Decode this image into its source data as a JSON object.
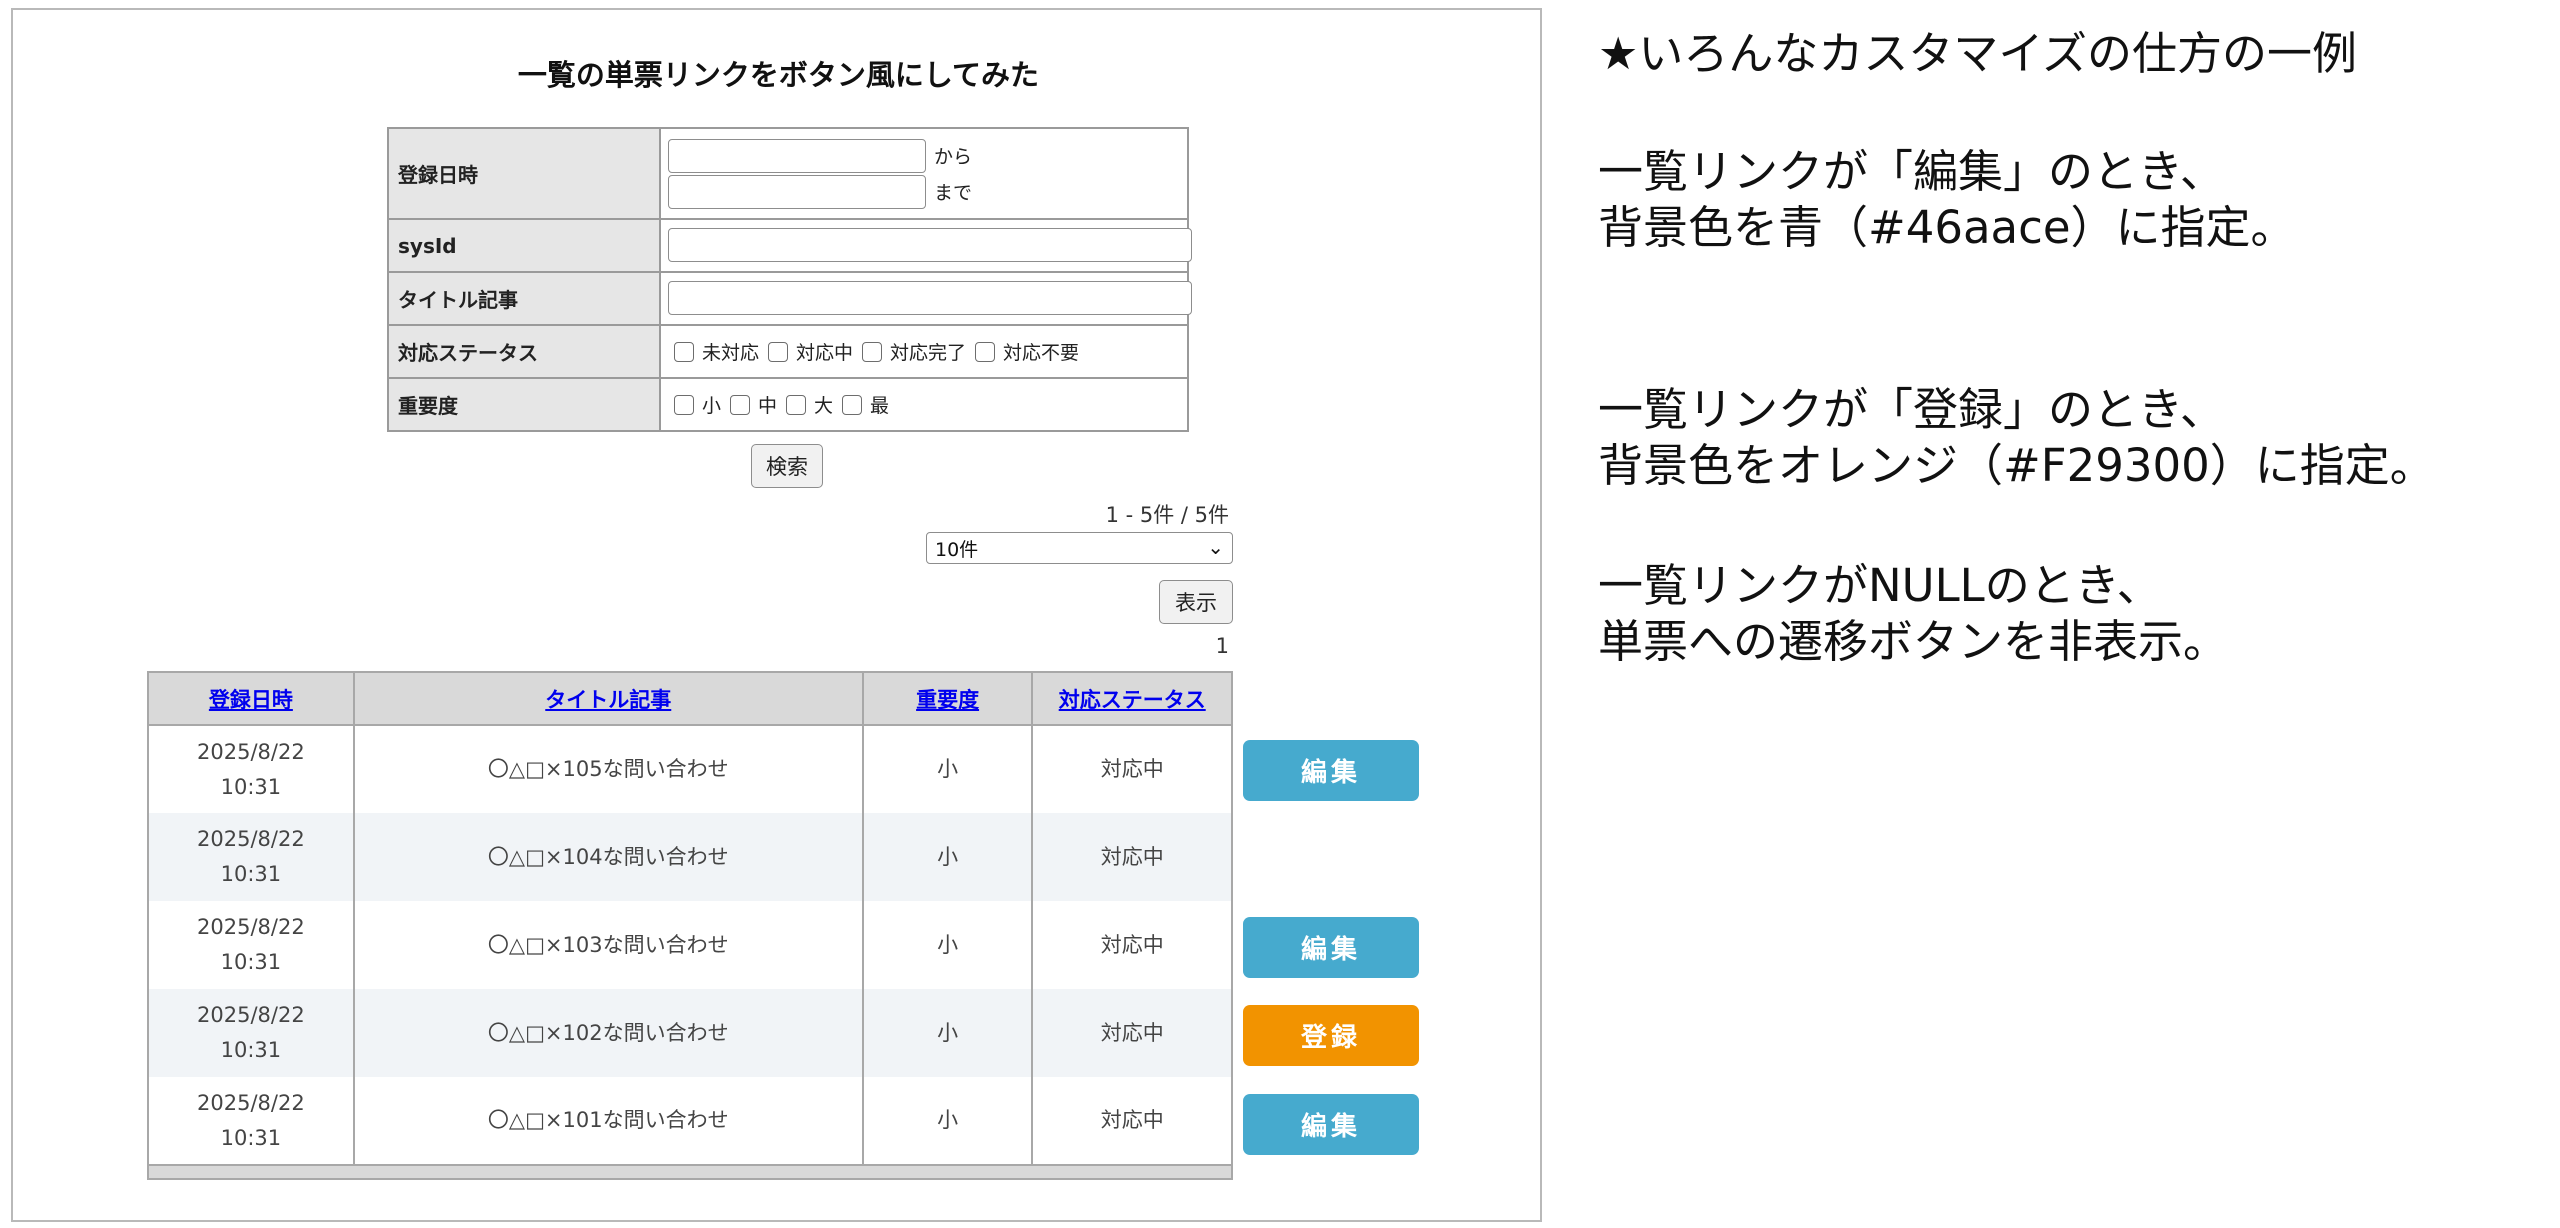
{
  "title": "一覧の単票リンクをボタン風にしてみた",
  "search_form": {
    "date_label": "登録日時",
    "from_label": "から",
    "to_label": "まで",
    "sysid_label": "sysId",
    "title_label": "タイトル記事",
    "status_label": "対応ステータス",
    "status_options": [
      "未対応",
      "対応中",
      "対応完了",
      "対応不要"
    ],
    "importance_label": "重要度",
    "importance_options": [
      "小",
      "中",
      "大",
      "最"
    ]
  },
  "search_button": "検索",
  "result_count": "1 - 5件 / 5件",
  "page_size": "10件",
  "show_button": "表示",
  "page_number": "1",
  "table": {
    "headers": [
      "登録日時",
      "タイトル記事",
      "重要度",
      "対応ステータス"
    ],
    "rows": [
      {
        "date": "2025/8/22",
        "time": "10:31",
        "title": "〇△□×105な問い合わせ",
        "importance": "小",
        "status": "対応中",
        "action": "編集",
        "action_color": "#46aace"
      },
      {
        "date": "2025/8/22",
        "time": "10:31",
        "title": "〇△□×104な問い合わせ",
        "importance": "小",
        "status": "対応中",
        "action": "",
        "action_color": ""
      },
      {
        "date": "2025/8/22",
        "time": "10:31",
        "title": "〇△□×103な問い合わせ",
        "importance": "小",
        "status": "対応中",
        "action": "編集",
        "action_color": "#46aace"
      },
      {
        "date": "2025/8/22",
        "time": "10:31",
        "title": "〇△□×102な問い合わせ",
        "importance": "小",
        "status": "対応中",
        "action": "登録",
        "action_color": "#F29300"
      },
      {
        "date": "2025/8/22",
        "time": "10:31",
        "title": "〇△□×101な問い合わせ",
        "importance": "小",
        "status": "対応中",
        "action": "編集",
        "action_color": "#46aace"
      }
    ]
  },
  "notes": [
    "★いろんなカスタマイズの仕方の一例",
    "一覧リンクが「編集」のとき、",
    "背景色を青（#46aace）に指定。",
    "一覧リンクが「登録」のとき、",
    "背景色をオレンジ（#F29300）に指定。",
    "一覧リンクがNULLのとき、",
    "単票への遷移ボタンを非表示。"
  ]
}
